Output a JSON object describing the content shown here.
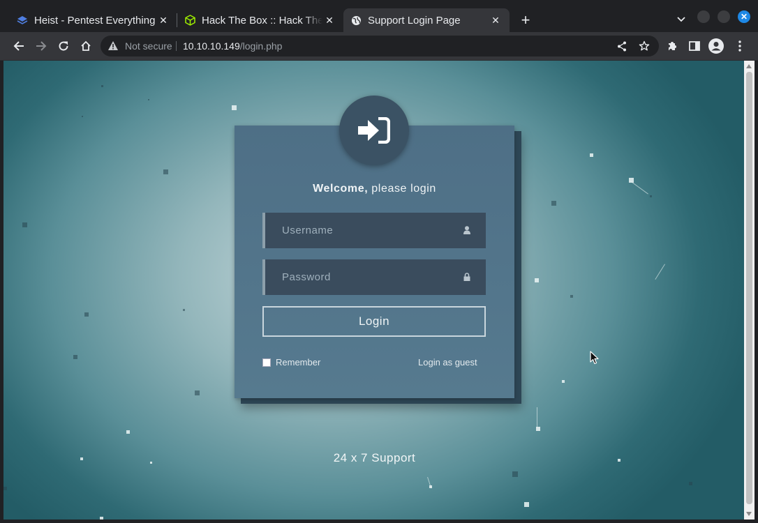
{
  "browser": {
    "tabs": [
      {
        "title": "Heist - Pentest Everything",
        "favicon": "layers-icon",
        "active": false
      },
      {
        "title": "Hack The Box :: Hack The Box",
        "favicon": "cube-icon",
        "active": false
      },
      {
        "title": "Support Login Page",
        "favicon": "globe-icon",
        "active": true
      }
    ],
    "new_tab_label": "+",
    "close_glyph": "✕",
    "address_bar": {
      "security_label": "Not secure",
      "host": "10.10.10.149",
      "path": "/login.php"
    },
    "colors": {
      "frame": "#202124",
      "toolbar": "#35363a",
      "close_button": "#1e88e5"
    }
  },
  "page": {
    "welcome_bold": "Welcome,",
    "welcome_rest": " please login",
    "username_placeholder": "Username",
    "password_placeholder": "Password",
    "login_button": "Login",
    "remember_label": "Remember",
    "guest_link": "Login as guest",
    "footer": "24 x 7 Support",
    "colors": {
      "card": "#4e6f86",
      "field": "#3a4c5d",
      "avatar": "#3b5264"
    }
  }
}
